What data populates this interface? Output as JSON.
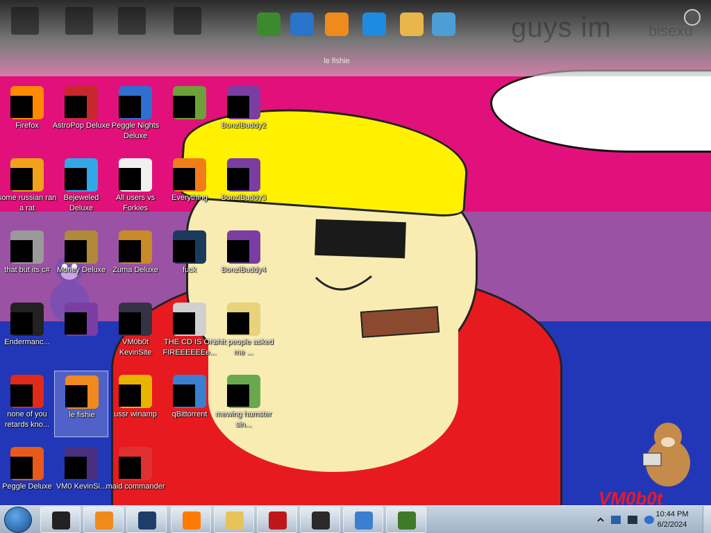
{
  "dock": {
    "label": "le fishie",
    "overlay_text": "guys im",
    "overlay_text2": "bisexu",
    "icons": [
      {
        "name": "minecraft-icon",
        "color": "#3d8a2e"
      },
      {
        "name": "globe-icon",
        "color": "#2a74c9"
      },
      {
        "name": "fish-icon",
        "color": "#f08a1d"
      },
      {
        "name": "internet-explorer-icon",
        "color": "#1e8be0"
      },
      {
        "name": "photo-viewer-icon",
        "color": "#e8b64a"
      },
      {
        "name": "users-icon",
        "color": "#4c9fd6"
      }
    ]
  },
  "desktop_icons": [
    {
      "label": "Firefox",
      "icon": "firefox-icon",
      "color": "#ff8a00"
    },
    {
      "label": "AstroPop Deluxe",
      "icon": "astropop-icon",
      "color": "#c8282d"
    },
    {
      "label": "Peggle Nights Deluxe",
      "icon": "peggle-nights-icon",
      "color": "#2f6fd0"
    },
    {
      "label": "",
      "icon": "plant-icon",
      "color": "#6da03b"
    },
    {
      "label": "BonziBuddy2",
      "icon": "bonzi-icon",
      "color": "#7a3ea3"
    },
    {
      "label": "some russian ran a rat",
      "icon": "rat-tool-icon",
      "color": "#f0a21a"
    },
    {
      "label": "Bejeweled Deluxe",
      "icon": "gem-icon",
      "color": "#31a7e8"
    },
    {
      "label": "All users vs Forkies",
      "icon": "flower-icon",
      "color": "#f0f0f0"
    },
    {
      "label": "Everything",
      "icon": "search-icon",
      "color": "#f07d1a"
    },
    {
      "label": "BonziBuddy3",
      "icon": "bonzi-icon",
      "color": "#7a3ea3"
    },
    {
      "label": "that but its c#",
      "icon": "copy-icon",
      "color": "#9a9a9a"
    },
    {
      "label": "Money Deluxe",
      "icon": "money-bag-icon",
      "color": "#b08a3a"
    },
    {
      "label": "Zuma Deluxe",
      "icon": "zuma-icon",
      "color": "#c98a2a"
    },
    {
      "label": "fuck",
      "icon": "steam-icon",
      "color": "#1b3a5c"
    },
    {
      "label": "BonziBuddy4",
      "icon": "bonzi-icon",
      "color": "#7a3ea3"
    },
    {
      "label": "Endermanc...",
      "icon": "terminal-icon",
      "color": "#222222"
    },
    {
      "label": "",
      "icon": "bonzi-icon",
      "color": "#7a3ea3"
    },
    {
      "label": "VM0b0t KevinSite",
      "icon": "kevinsite-icon",
      "color": "#334"
    },
    {
      "label": "THE CD IS ON FIREEEEEEe...",
      "icon": "cd-burn-icon",
      "color": "#d0d0d0"
    },
    {
      "label": "shit people asked me ...",
      "icon": "folder-icon",
      "color": "#e8d27a"
    },
    {
      "label": "none of you retards kno...",
      "icon": "red-circle-icon",
      "color": "#e02a1a"
    },
    {
      "label": "le fishie",
      "icon": "fish-icon",
      "color": "#f08a1d"
    },
    {
      "label": "ussr winamp",
      "icon": "winamp-icon",
      "color": "#e8b400"
    },
    {
      "label": "qBittorrent",
      "icon": "qbittorrent-icon",
      "color": "#3b7fd0"
    },
    {
      "label": "mewing hamster sin...",
      "icon": "hamster-icon",
      "color": "#6aa84f"
    },
    {
      "label": "Peggle Deluxe",
      "icon": "peggle-icon",
      "color": "#e85a1a"
    },
    {
      "label": "VM0 KevinSi...",
      "icon": "document-icon",
      "color": "#4a2f80"
    },
    {
      "label": "maid commander",
      "icon": "paint-icon",
      "color": "#e03030"
    }
  ],
  "taskbar": {
    "apps": [
      {
        "name": "taskbar-app-computer",
        "color": "#222222"
      },
      {
        "name": "taskbar-app-media-player",
        "color": "#f08a1d"
      },
      {
        "name": "taskbar-app-globe",
        "color": "#1e3e6a"
      },
      {
        "name": "taskbar-app-firefox",
        "color": "#ff7a00"
      },
      {
        "name": "taskbar-app-explorer",
        "color": "#e8c25a"
      },
      {
        "name": "taskbar-app-filezilla",
        "color": "#c0161a"
      },
      {
        "name": "taskbar-app-terminal",
        "color": "#2a2a2a"
      },
      {
        "name": "taskbar-app-qbittorrent",
        "color": "#3b7fd0"
      },
      {
        "name": "taskbar-app-tree",
        "color": "#3e7a2a"
      }
    ],
    "time": "10:44 PM",
    "date": "6/2/2024"
  },
  "brand_text": "VM0b0t"
}
